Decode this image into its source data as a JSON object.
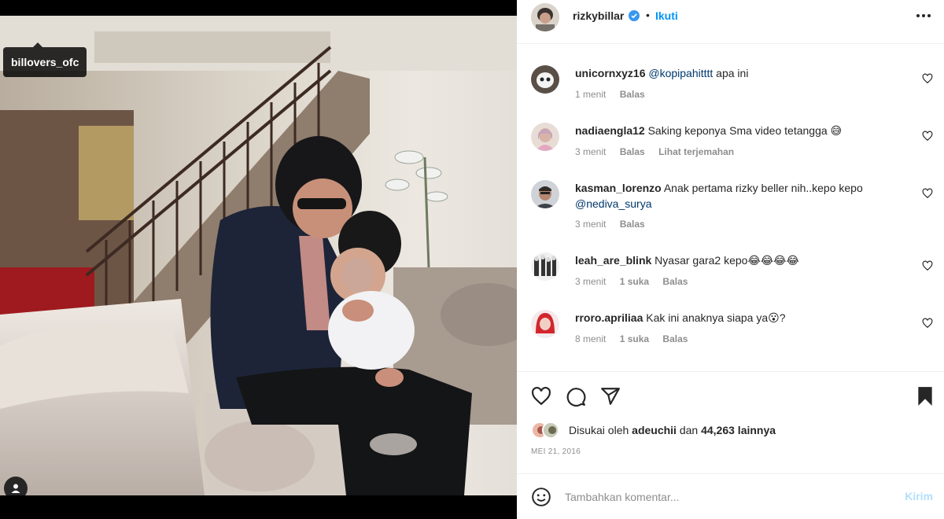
{
  "media": {
    "tag_user": "billovers_ofc",
    "user_tag_icon": "user-icon"
  },
  "post": {
    "author": "rizkybillar",
    "separator": "•",
    "follow_label": "Ikuti",
    "verified_icon": "verified-badge-icon",
    "more_icon": "more-horizontal-icon"
  },
  "comments": [
    {
      "user": "unicornxyz16",
      "mention": "@kopipahitttt",
      "text": " apa ini",
      "time": "1 menit",
      "reply": "Balas",
      "likes": "",
      "translate": ""
    },
    {
      "user": "nadiaengla12",
      "mention": "",
      "text": "Saking keponya Sma video tetangga",
      "emoji": "😅",
      "time": "3 menit",
      "reply": "Balas",
      "likes": "",
      "translate": "Lihat terjemahan"
    },
    {
      "user": "kasman_lorenzo",
      "mention": "",
      "text": "Anak pertama rizky beller nih..kepo kepo",
      "mention2": "@nediva_surya",
      "time": "3 menit",
      "reply": "Balas",
      "likes": "",
      "translate": ""
    },
    {
      "user": "leah_are_blink",
      "mention": "",
      "text": "Nyasar gara2 kepo",
      "emoji": "😂😂😂😂",
      "time": "3 menit",
      "reply": "Balas",
      "likes": "1 suka",
      "translate": ""
    },
    {
      "user": "rroro.apriliaa",
      "mention": "",
      "text": "Kak ini anaknya siapa ya",
      "emoji": "😮",
      "text_after": "?",
      "time": "8 menit",
      "reply": "Balas",
      "likes": "1 suka",
      "translate": ""
    }
  ],
  "actions": {
    "like_icon": "heart-icon",
    "comment_icon": "comment-icon",
    "share_icon": "send-icon",
    "save_icon": "bookmark-icon"
  },
  "likes": {
    "prefix": "Disukai oleh",
    "user": "adeuchii",
    "middle": "dan",
    "count": "44,263 lainnya"
  },
  "date": "MEI 21, 2016",
  "composer": {
    "placeholder": "Tambahkan komentar...",
    "send_label": "Kirim",
    "emoji_icon": "smiley-icon"
  }
}
